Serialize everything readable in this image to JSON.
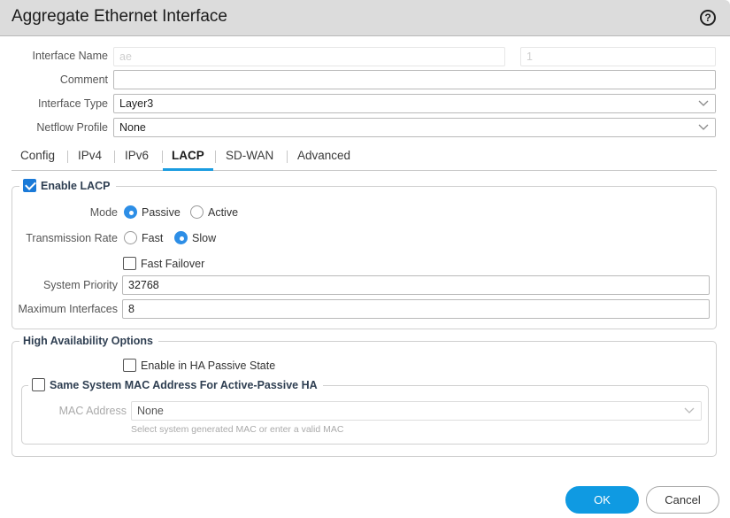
{
  "dialog": {
    "title": "Aggregate Ethernet Interface",
    "help_icon": "question-circle-icon"
  },
  "form": {
    "interface_name_label": "Interface Name",
    "interface_name_prefix": "ae",
    "interface_name_suffix": "1",
    "comment_label": "Comment",
    "comment_value": "",
    "interface_type_label": "Interface Type",
    "interface_type_value": "Layer3",
    "netflow_profile_label": "Netflow Profile",
    "netflow_profile_value": "None"
  },
  "tabs": [
    {
      "label": "Config",
      "active": false
    },
    {
      "label": "IPv4",
      "active": false
    },
    {
      "label": "IPv6",
      "active": false
    },
    {
      "label": "LACP",
      "active": true
    },
    {
      "label": "SD-WAN",
      "active": false
    },
    {
      "label": "Advanced",
      "active": false
    }
  ],
  "lacp": {
    "enable_label": "Enable LACP",
    "enable_checked": true,
    "mode_label": "Mode",
    "mode_options": [
      {
        "label": "Passive",
        "selected": true
      },
      {
        "label": "Active",
        "selected": false
      }
    ],
    "rate_label": "Transmission Rate",
    "rate_options": [
      {
        "label": "Fast",
        "selected": false
      },
      {
        "label": "Slow",
        "selected": true
      }
    ],
    "fast_failover_label": "Fast Failover",
    "fast_failover_checked": false,
    "system_priority_label": "System Priority",
    "system_priority_value": "32768",
    "max_interfaces_label": "Maximum Interfaces",
    "max_interfaces_value": "8"
  },
  "ha": {
    "title": "High Availability Options",
    "passive_state_label": "Enable in HA Passive State",
    "passive_state_checked": false,
    "same_mac_label": "Same System MAC Address For Active-Passive HA",
    "same_mac_checked": false,
    "mac_label": "MAC Address",
    "mac_value": "None",
    "mac_hint": "Select system generated MAC or enter a valid MAC"
  },
  "buttons": {
    "ok": "OK",
    "cancel": "Cancel"
  },
  "colors": {
    "accent": "#0f9ae2",
    "checkbox": "#1a7ad8",
    "header_bg": "#dcdcdc"
  }
}
